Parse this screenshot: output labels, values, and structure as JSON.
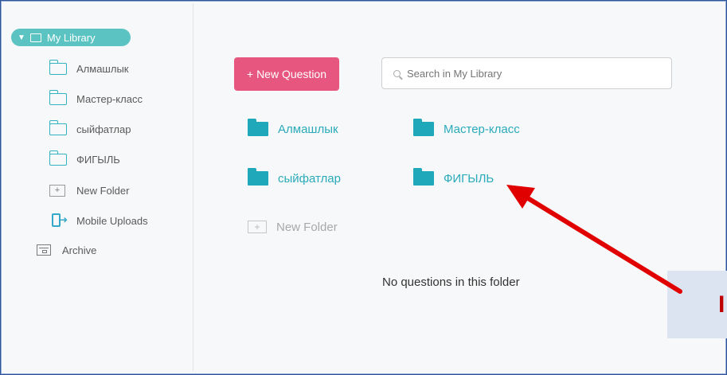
{
  "sidebar": {
    "root_label": "My Library",
    "items": [
      {
        "label": "Алмашлык",
        "icon": "folder-icon"
      },
      {
        "label": "Мастер-класс",
        "icon": "folder-icon"
      },
      {
        "label": "сыйфатлар",
        "icon": "folder-icon"
      },
      {
        "label": "ФИГЫЛЬ",
        "icon": "folder-icon"
      },
      {
        "label": "New Folder",
        "icon": "new-folder-icon"
      },
      {
        "label": "Mobile Uploads",
        "icon": "mobile-upload-icon"
      }
    ],
    "archive_label": "Archive"
  },
  "toolbar": {
    "new_question_label": "+ New Question",
    "search_placeholder": "Search in My Library"
  },
  "folders": [
    {
      "label": "Алмашлык"
    },
    {
      "label": "Мастер-класс"
    },
    {
      "label": "сыйфатлар"
    },
    {
      "label": "ФИГЫЛЬ"
    }
  ],
  "new_folder_label": "New Folder",
  "empty_message": "No questions in this folder",
  "callout_text": "I",
  "colors": {
    "accent": "#5cc3c3",
    "button": "#e7567e",
    "folder": "#1fa8ba",
    "arrow": "#e00000"
  }
}
